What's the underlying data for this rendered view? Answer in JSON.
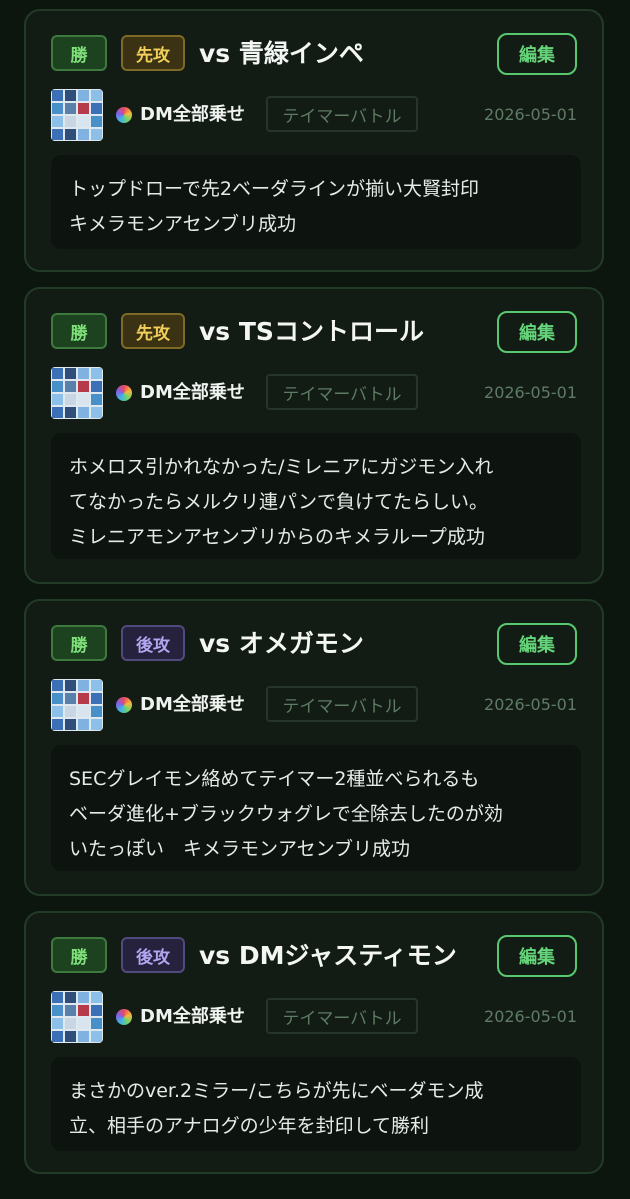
{
  "cards": [
    {
      "result": "勝",
      "turn": "先攻",
      "turn_kind": "first",
      "opponent": "vs 青緑インペ",
      "edit_label": "編集",
      "deck_name": "DM全部乗せ",
      "format": "テイマーバトル",
      "date": "2026-05-01",
      "note_lines": [
        "トップドローで先2ベーダラインが揃い大賢封印",
        "キメラモンアセンブリ成功"
      ]
    },
    {
      "result": "勝",
      "turn": "先攻",
      "turn_kind": "first",
      "opponent": "vs TSコントロール",
      "edit_label": "編集",
      "deck_name": "DM全部乗せ",
      "format": "テイマーバトル",
      "date": "2026-05-01",
      "note_lines": [
        "ホメロス引かれなかった/ミレニアにガジモン入れ",
        "てなかったらメルクリ連パンで負けてたらしい。",
        "ミレニアモンアセンブリからのキメラループ成功"
      ]
    },
    {
      "result": "勝",
      "turn": "後攻",
      "turn_kind": "second",
      "opponent": "vs オメガモン",
      "edit_label": "編集",
      "deck_name": "DM全部乗せ",
      "format": "テイマーバトル",
      "date": "2026-05-01",
      "note_lines": [
        "SECグレイモン絡めてテイマー2種並べられるも",
        "ベーダ進化+ブラックウォグレで全除去したのが効",
        "いたっぽい　キメラモンアセンブリ成功"
      ]
    },
    {
      "result": "勝",
      "turn": "後攻",
      "turn_kind": "second",
      "opponent": "vs DMジャスティモン",
      "edit_label": "編集",
      "deck_name": "DM全部乗せ",
      "format": "テイマーバトル",
      "date": "2026-05-01",
      "note_lines": [
        "まさかのver.2ミラー/こちらが先にベーダモン成",
        "立、相手のアナログの少年を封印して勝利"
      ]
    }
  ],
  "icons": {
    "deck_thumbnail": "deck-thumbnail-icon",
    "deck_color_dot": "multicolor-dot-icon"
  }
}
